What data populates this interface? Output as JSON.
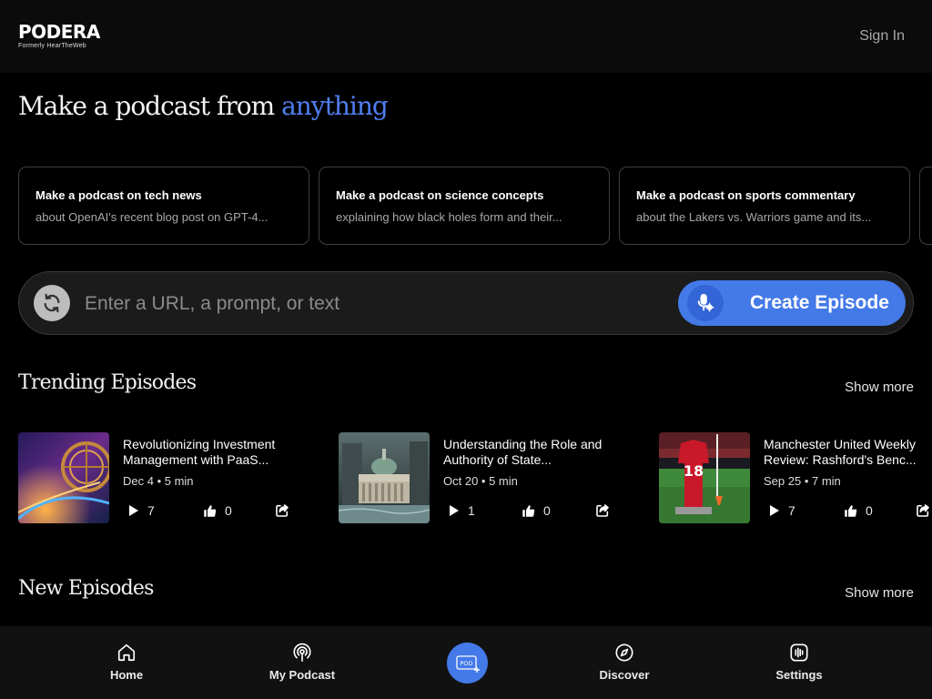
{
  "header": {
    "logo_name": "PODERA",
    "logo_sub": "Formerly HearTheWeb",
    "signin_label": "Sign In"
  },
  "hero": {
    "text": "Make a podcast from ",
    "accent": "anything",
    "accent_color": "#4f7ff0"
  },
  "suggestions": [
    {
      "title": "Make a podcast on tech news",
      "subtitle": "about OpenAI's recent blog post on GPT-4..."
    },
    {
      "title": "Make a podcast on science concepts",
      "subtitle": "explaining how black holes form and their..."
    },
    {
      "title": "Make a podcast on sports commentary",
      "subtitle": "about the Lakers vs. Warriors game and its..."
    }
  ],
  "input": {
    "placeholder": "Enter a URL, a prompt, or text",
    "value": "",
    "create_label": "Create Episode",
    "refresh_icon": "refresh-icon",
    "mic_icon": "mic-settings-icon"
  },
  "trending": {
    "title": "Trending Episodes",
    "show_more": "Show more",
    "episodes": [
      {
        "title": "Revolutionizing Investment Management with PaaS...",
        "meta": "Dec 4 • 5 min",
        "plays": "7",
        "likes": "0"
      },
      {
        "title": "Understanding the Role and Authority of State...",
        "meta": "Oct 20 • 5 min",
        "plays": "1",
        "likes": "0"
      },
      {
        "title": "Manchester United Weekly Review: Rashford's Benc...",
        "meta": "Sep 25 • 7 min",
        "plays": "7",
        "likes": "0"
      }
    ]
  },
  "new_episodes": {
    "title": "New Episodes",
    "show_more": "Show more"
  },
  "nav": {
    "home": "Home",
    "my_podcast": "My Podcast",
    "pod_label": "POD",
    "discover": "Discover",
    "settings": "Settings"
  },
  "colors": {
    "accent": "#4479e8",
    "background": "#000000",
    "nav_background": "#111111"
  }
}
